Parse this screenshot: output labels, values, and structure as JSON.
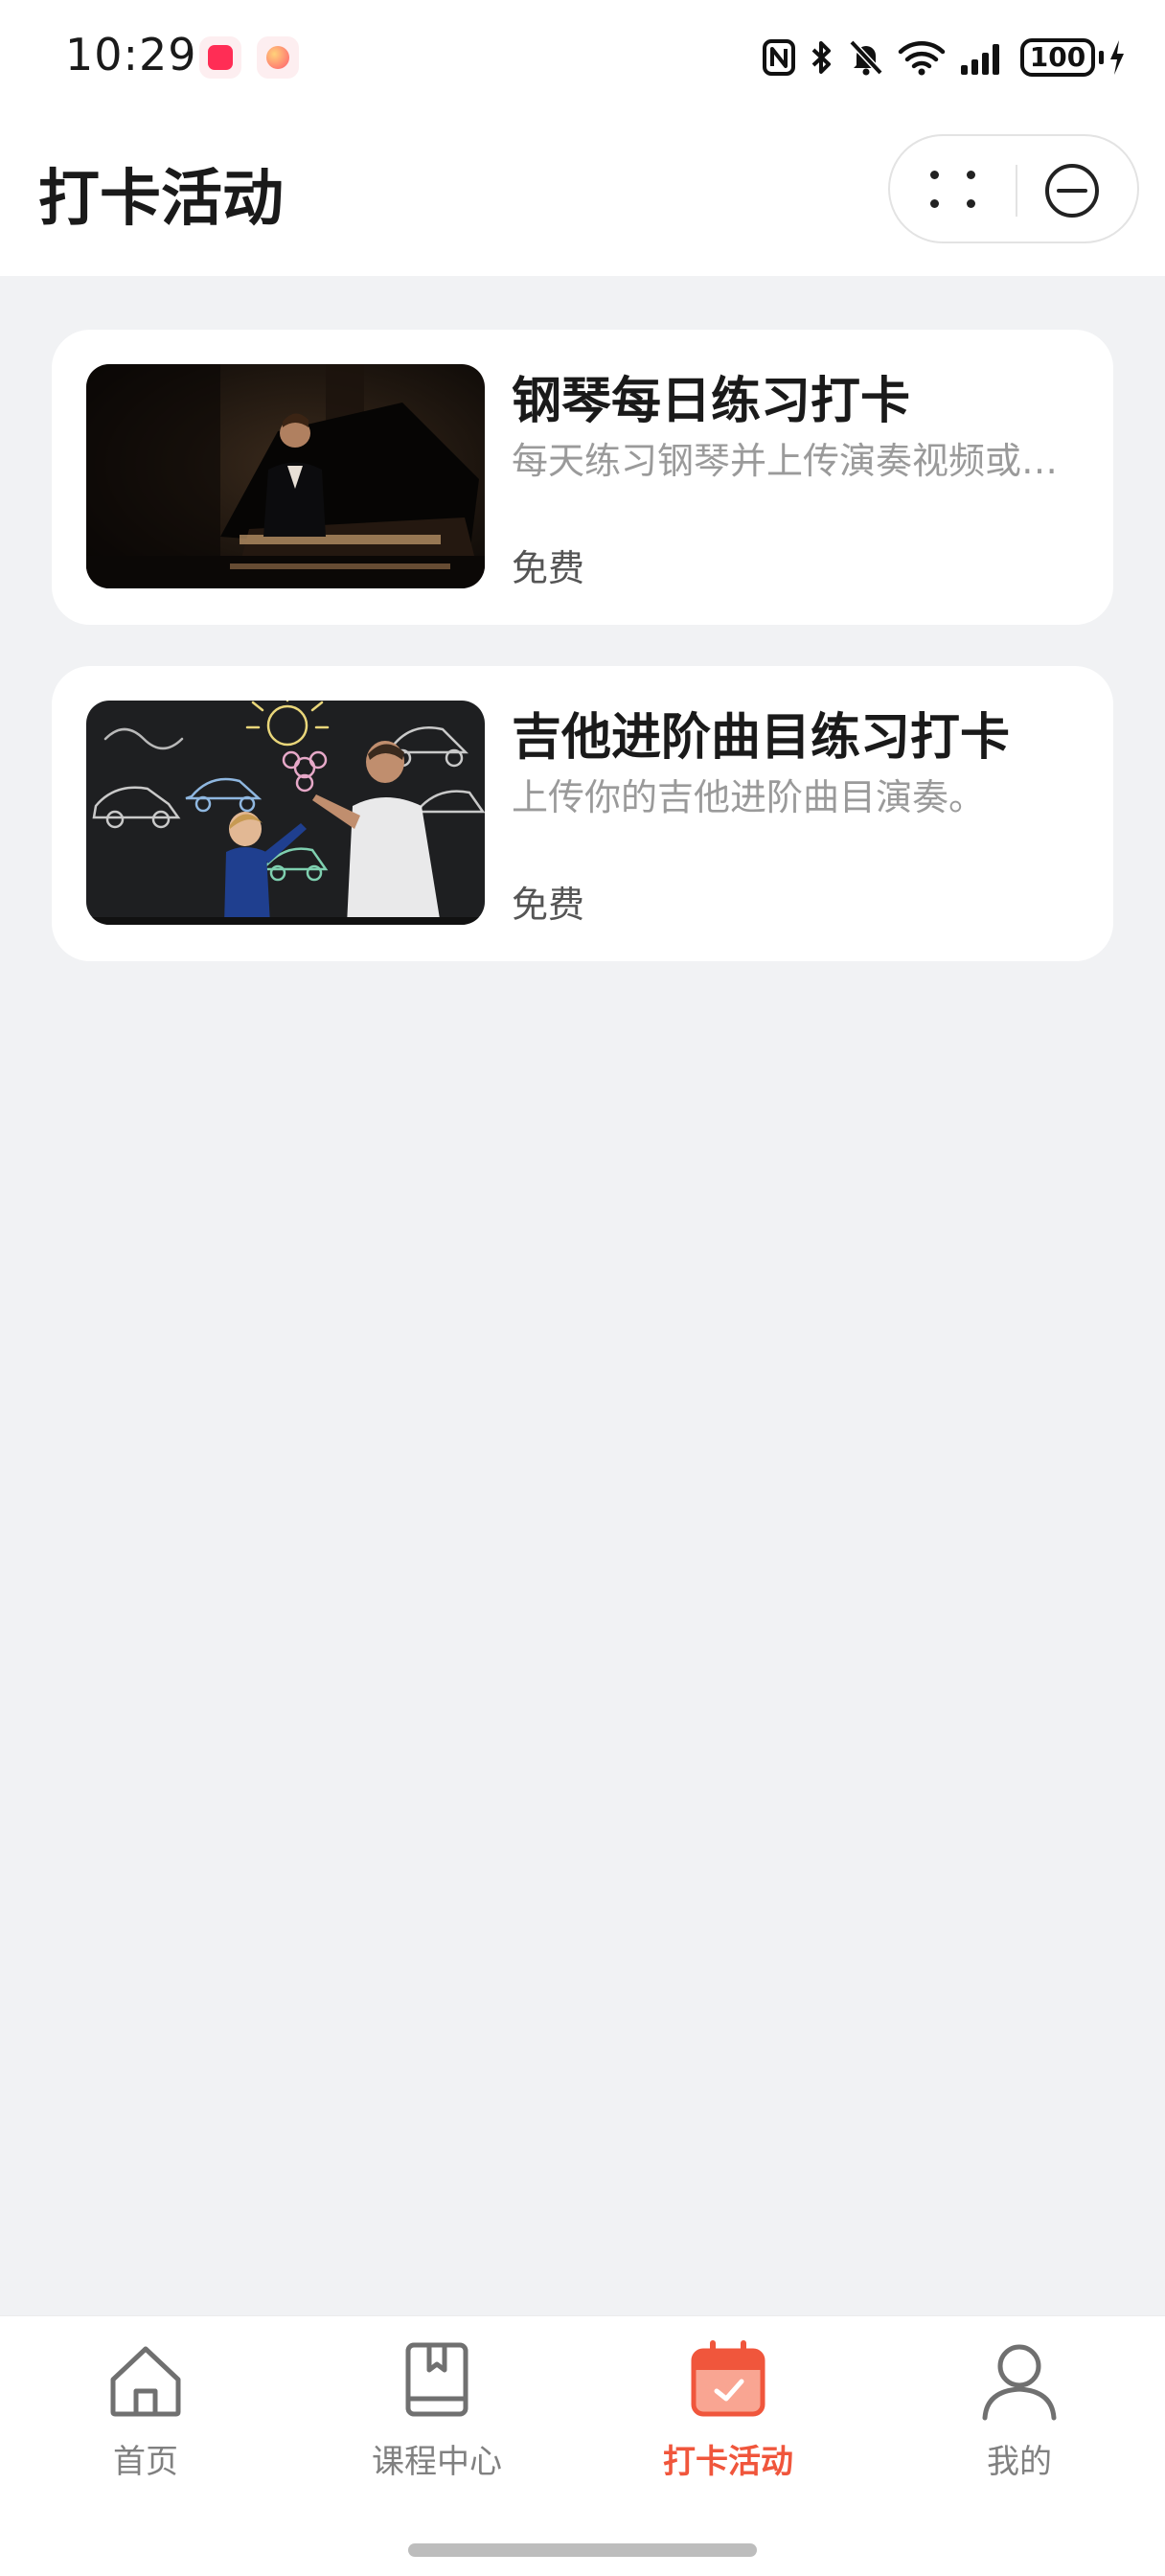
{
  "status_bar": {
    "time": "10:29",
    "battery": "100"
  },
  "header": {
    "title": "打卡活动"
  },
  "cards": [
    {
      "title": "钢琴每日练习打卡",
      "description": "每天练习钢琴并上传演奏视频或录音",
      "price": "免费",
      "image": "pianist-on-stage-photo"
    },
    {
      "title": "吉他进阶曲目练习打卡",
      "description": "上传你的吉他进阶曲目演奏。",
      "price": "免费",
      "image": "father-and-child-drawing-on-chalkboard-photo"
    }
  ],
  "tab_bar": {
    "items": [
      {
        "label": "首页",
        "icon": "home-icon",
        "active": false
      },
      {
        "label": "课程中心",
        "icon": "book-icon",
        "active": false
      },
      {
        "label": "打卡活动",
        "icon": "calendar-check-icon",
        "active": true
      },
      {
        "label": "我的",
        "icon": "person-icon",
        "active": false
      }
    ],
    "active_color": "#f0563c",
    "inactive_color": "#808080"
  }
}
